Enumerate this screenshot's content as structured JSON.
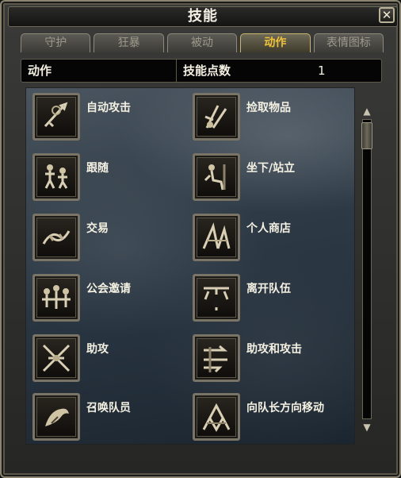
{
  "window": {
    "title": "技能"
  },
  "tabs": [
    {
      "label": "守护",
      "active": false
    },
    {
      "label": "狂暴",
      "active": false
    },
    {
      "label": "被动",
      "active": false
    },
    {
      "label": "动作",
      "active": true
    },
    {
      "label": "表情图标",
      "active": false
    }
  ],
  "infobar": {
    "category": "动作",
    "points_label": "技能点数",
    "points_value": "1"
  },
  "skills": [
    {
      "label": "自动攻击",
      "icon": "auto-attack-icon"
    },
    {
      "label": "捡取物品",
      "icon": "pickup-icon"
    },
    {
      "label": "跟随",
      "icon": "follow-icon"
    },
    {
      "label": "坐下/站立",
      "icon": "sit-stand-icon"
    },
    {
      "label": "交易",
      "icon": "trade-icon"
    },
    {
      "label": "个人商店",
      "icon": "private-store-icon"
    },
    {
      "label": "公会邀请",
      "icon": "guild-invite-icon"
    },
    {
      "label": "离开队伍",
      "icon": "leave-party-icon"
    },
    {
      "label": "助攻",
      "icon": "assist-icon"
    },
    {
      "label": "助攻和攻击",
      "icon": "assist-attack-icon"
    },
    {
      "label": "召唤队员",
      "icon": "summon-member-icon"
    },
    {
      "label": "向队长方向移动",
      "icon": "move-to-leader-icon"
    }
  ]
}
